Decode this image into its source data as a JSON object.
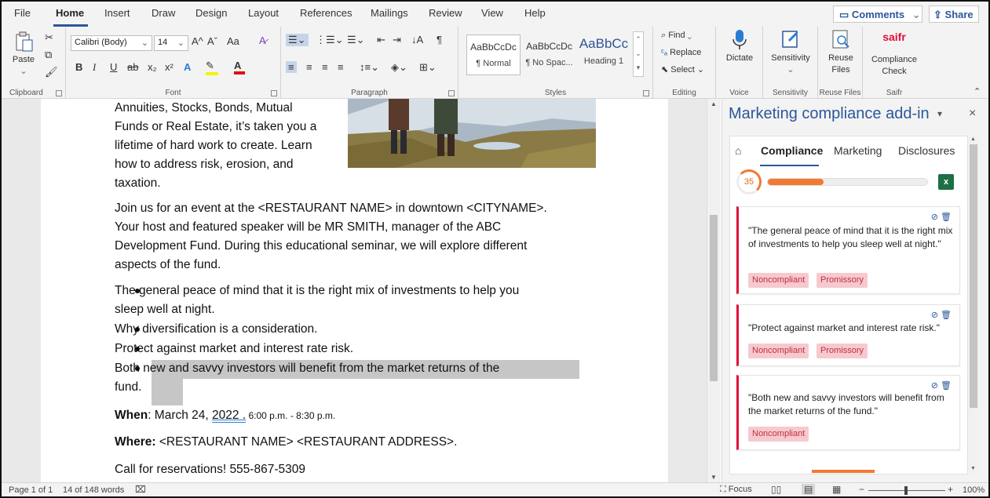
{
  "menu": {
    "tabs": [
      "File",
      "Home",
      "Insert",
      "Draw",
      "Design",
      "Layout",
      "References",
      "Mailings",
      "Review",
      "View",
      "Help"
    ],
    "comments": "Comments",
    "share": "Share"
  },
  "ribbon": {
    "clipboard": {
      "paste": "Paste",
      "label": "Clipboard"
    },
    "font": {
      "name": "Calibri (Body)",
      "size": "14",
      "label": "Font",
      "bold": "B",
      "italic": "I",
      "underline": "U",
      "strike": "ab",
      "sub": "x₂",
      "sup": "x²",
      "grow": "A^",
      "shrink": "Aˇ",
      "case": "Aa"
    },
    "paragraph": {
      "label": "Paragraph"
    },
    "styles": {
      "items": [
        {
          "preview": "AaBbCcDc",
          "name": "¶ Normal"
        },
        {
          "preview": "AaBbCcDc",
          "name": "¶ No Spac..."
        },
        {
          "preview": "AaBbCc",
          "name": "Heading 1"
        }
      ],
      "label": "Styles"
    },
    "editing": {
      "find": "Find",
      "replace": "Replace",
      "select": "Select",
      "label": "Editing"
    },
    "voice": {
      "dictate": "Dictate",
      "label": "Voice"
    },
    "sensitivity": {
      "btn": "Sensitivity",
      "label": "Sensitivity"
    },
    "reuse": {
      "btn1": "Reuse",
      "btn2": "Files",
      "label": "Reuse Files"
    },
    "saifr": {
      "logo": "saifr",
      "btn1": "Compliance",
      "btn2": "Check",
      "label": "Saifr"
    }
  },
  "doc": {
    "lines_intro": [
      "Annuities, Stocks, Bonds, Mutual",
      "Funds or Real Estate, it’s taken you a",
      "lifetime of hard work to create.  Learn",
      "how to address risk, erosion, and",
      "taxation."
    ],
    "para2": [
      "Join us for an event at the <RESTAURANT NAME> in downtown <CITYNAME>.",
      "Your host and featured speaker will be MR SMITH, manager of the ABC",
      "Development Fund.  During this educational seminar, we will explore different",
      "aspects of the fund."
    ],
    "bullets": [
      [
        "The general peace of mind that it is the right mix of investments to help you",
        "sleep well at night."
      ],
      [
        "Why diversification is a consideration."
      ],
      [
        "Protect against market and interest rate risk."
      ],
      [
        "Both new and savvy investors will benefit from the market returns of the",
        "fund."
      ]
    ],
    "when_label": "When",
    "when_date": ": March 24, ",
    "when_year": "2022 .",
    "when_time": " 6:00 p.m. - 8:30 p.m.",
    "where_label": "Where:",
    "where_value": " <RESTAURANT NAME> <RESTAURANT ADDRESS>.",
    "call": "Call for reservations! 555-867-5309"
  },
  "pane": {
    "title": "Marketing compliance add-in",
    "tabs": [
      "Compliance",
      "Marketing",
      "Disclosures"
    ],
    "score": "35",
    "score_fraction": 0.35,
    "cards": [
      {
        "text": "\"The general peace of mind that it is the right mix of investments to help you sleep well at night.\"",
        "tags": [
          "Noncompliant",
          "Promissory"
        ]
      },
      {
        "text": "\"Protect against market and interest rate risk.\"",
        "tags": [
          "Noncompliant",
          "Promissory"
        ]
      },
      {
        "text": "\"Both new and savvy investors will benefit from the market returns of the fund.\"",
        "tags": [
          "Noncompliant"
        ]
      }
    ]
  },
  "status": {
    "page": "Page 1 of 1",
    "words": "14 of 148 words",
    "focus": "Focus",
    "zoom": "100%"
  },
  "colors": {
    "accent": "#2b579a",
    "noncompliant": "#e0103a",
    "tag_bg": "#f6c9cf",
    "progress": "#f07a32"
  }
}
